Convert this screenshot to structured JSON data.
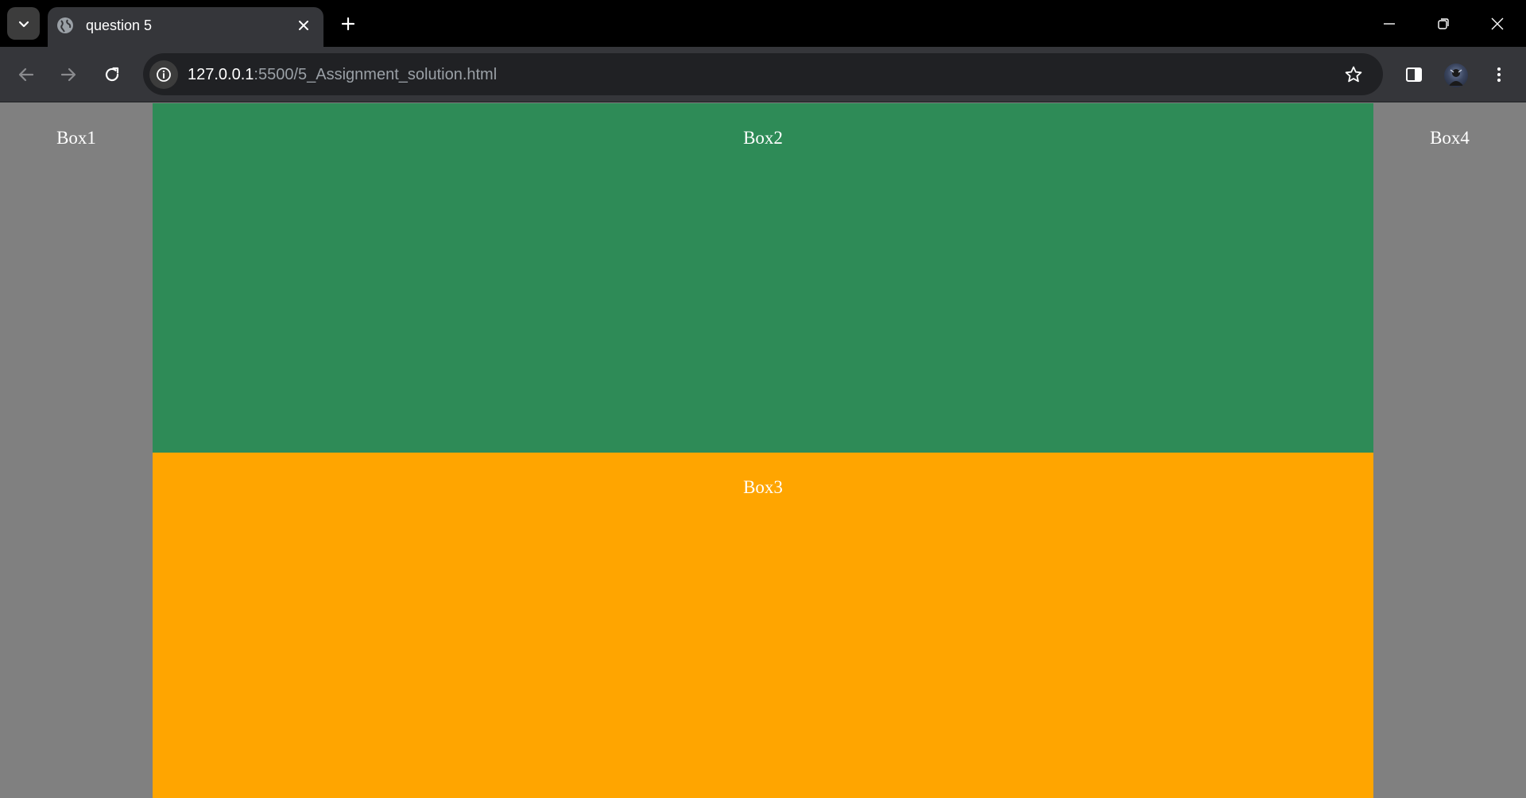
{
  "browser": {
    "tab": {
      "title": "question 5"
    },
    "address_bar": {
      "url_host": "127.0.0.1",
      "url_rest": ":5500/5_Assignment_solution.html"
    },
    "icons": {
      "tab_search": "chevron-down-icon",
      "favicon": "globe-icon",
      "tab_close": "close-icon",
      "new_tab": "plus-icon",
      "back": "arrow-left-icon",
      "forward": "arrow-right-icon",
      "reload": "reload-icon",
      "site_info": "info-icon",
      "bookmark": "star-icon",
      "side_panel": "side-panel-icon",
      "menu": "kebab-menu-icon"
    }
  },
  "page": {
    "boxes": [
      {
        "label": "Box1",
        "color": "#808080"
      },
      {
        "label": "Box2",
        "color": "#2e8b57"
      },
      {
        "label": "Box3",
        "color": "#ffa500"
      },
      {
        "label": "Box4",
        "color": "#808080"
      }
    ]
  }
}
